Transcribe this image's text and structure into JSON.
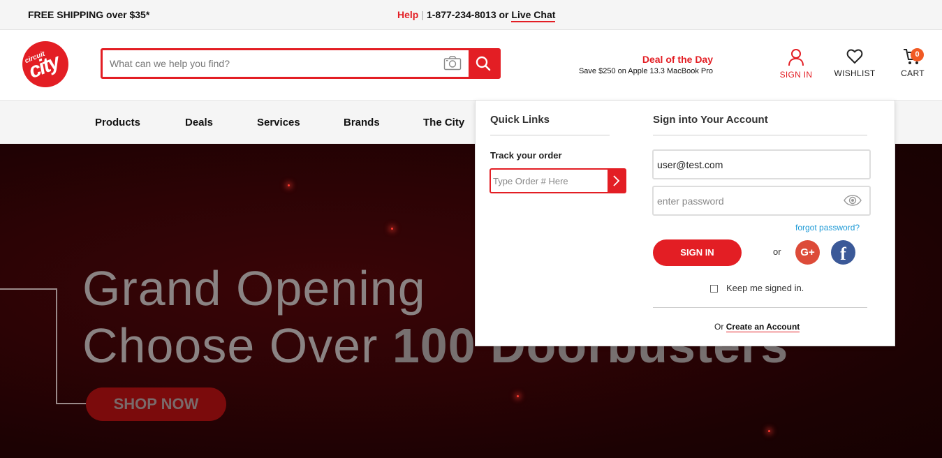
{
  "topbar": {
    "shipping": "FREE SHIPPING over $35*",
    "help": "Help",
    "separator": "|",
    "phone": "1-877-234-8013 or",
    "live_chat": "Live Chat"
  },
  "header": {
    "logo_small": "circuit",
    "logo_big": "city",
    "search_placeholder": "What can we help you find?",
    "deal_title": "Deal of the Day",
    "deal_text": "Save $250 on Apple 13.3 MacBook Pro",
    "sign_in": "SIGN IN",
    "wishlist": "WISHLIST",
    "cart": "CART",
    "cart_count": "0"
  },
  "nav": {
    "items": [
      "Products",
      "Deals",
      "Services",
      "Brands",
      "The City"
    ]
  },
  "hero": {
    "line1": "Grand Opening",
    "line2_regular": "Choose Over",
    "line2_bold": "100 Doorbusters",
    "cta": "SHOP NOW"
  },
  "dropdown": {
    "quick_links_title": "Quick Links",
    "track_label": "Track your order",
    "track_placeholder": "Type Order # Here",
    "signin_title": "Sign into Your Account",
    "email_value": "user@test.com",
    "password_placeholder": "enter password",
    "forgot": "forgot password?",
    "signin_button": "SIGN IN",
    "or": "or",
    "google": "G+",
    "facebook": "f",
    "keep_signed_in": "Keep me signed in.",
    "create_prefix": "Or",
    "create_link": "Create an Account"
  },
  "colors": {
    "brand_red": "#e31e24",
    "link_blue": "#1e9ad6",
    "google_red": "#dd4b39",
    "facebook_blue": "#3b5998",
    "cart_badge": "#f15a24"
  }
}
